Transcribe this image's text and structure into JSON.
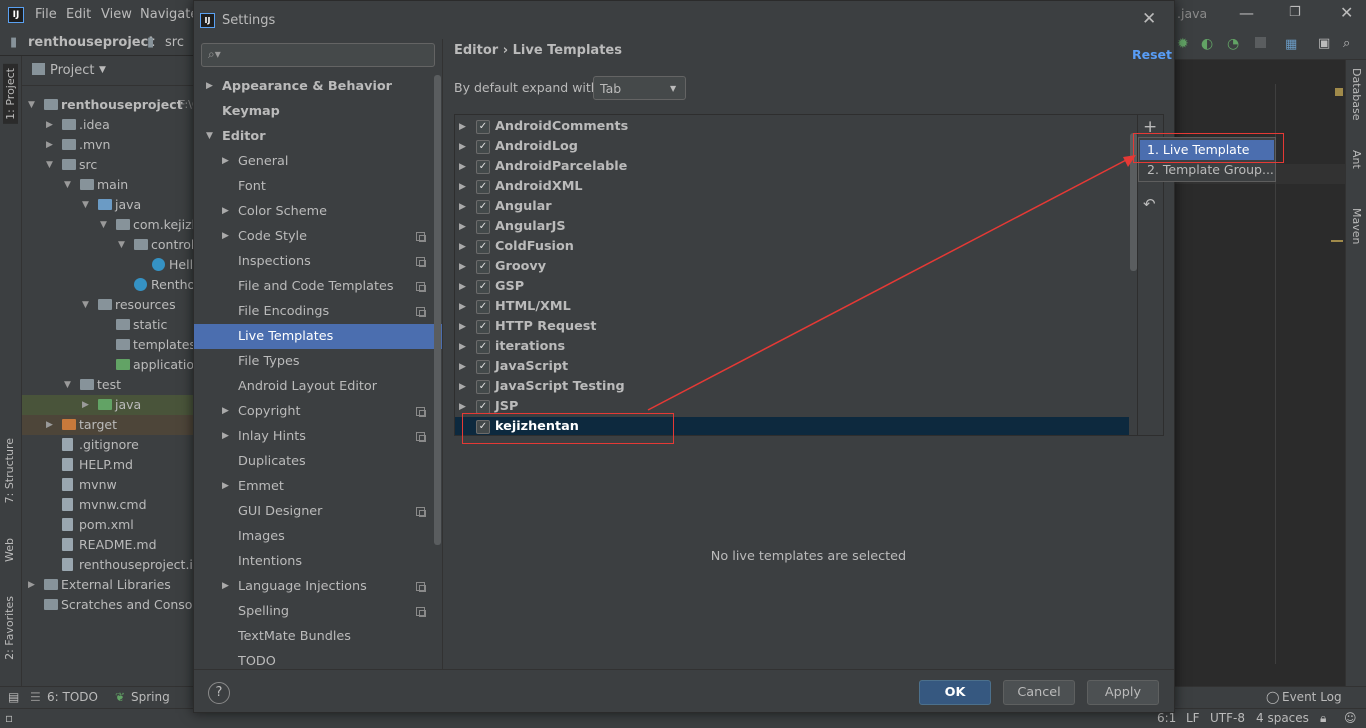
{
  "ide": {
    "menu": [
      "File",
      "Edit",
      "View",
      "Navigate"
    ],
    "breadcrumb": [
      "renthouseproject",
      "src"
    ],
    "left_tabs": [
      "1: Project",
      "7: Structure",
      "Web",
      "2: Favorites"
    ],
    "right_tabs": [
      "Database",
      "Ant",
      "Maven"
    ],
    "editor_tab": ".java",
    "project_panel_title": "Project",
    "tree": [
      {
        "label": "renthouseproject",
        "suffix": "F:\\C",
        "depth": 0,
        "arrow": "▼",
        "icon": "folder-icon",
        "bold": true
      },
      {
        "label": ".idea",
        "depth": 1,
        "arrow": "▶",
        "icon": "folder-icon"
      },
      {
        "label": ".mvn",
        "depth": 1,
        "arrow": "▶",
        "icon": "folder-icon"
      },
      {
        "label": "src",
        "depth": 1,
        "arrow": "▼",
        "icon": "folder-icon"
      },
      {
        "label": "main",
        "depth": 2,
        "arrow": "▼",
        "icon": "folder-icon"
      },
      {
        "label": "java",
        "depth": 3,
        "arrow": "▼",
        "icon": "source-folder-icon"
      },
      {
        "label": "com.kejizh",
        "depth": 4,
        "arrow": "▼",
        "icon": "package-icon"
      },
      {
        "label": "control",
        "depth": 5,
        "arrow": "▼",
        "icon": "package-icon"
      },
      {
        "label": "Hell",
        "depth": 6,
        "arrow": "",
        "icon": "class-icon"
      },
      {
        "label": "Rentho",
        "depth": 5,
        "arrow": "",
        "icon": "class-icon"
      },
      {
        "label": "resources",
        "depth": 3,
        "arrow": "▼",
        "icon": "resources-folder-icon"
      },
      {
        "label": "static",
        "depth": 4,
        "arrow": "",
        "icon": "folder-icon"
      },
      {
        "label": "templates",
        "depth": 4,
        "arrow": "",
        "icon": "folder-icon"
      },
      {
        "label": "application",
        "depth": 4,
        "arrow": "",
        "icon": "spring-config-icon"
      },
      {
        "label": "test",
        "depth": 2,
        "arrow": "▼",
        "icon": "folder-icon"
      },
      {
        "label": "java",
        "depth": 3,
        "arrow": "▶",
        "icon": "test-folder-icon",
        "highlight": true
      },
      {
        "label": "target",
        "depth": 1,
        "arrow": "▶",
        "icon": "excluded-folder-icon",
        "highlight": true
      },
      {
        "label": ".gitignore",
        "depth": 1,
        "arrow": "",
        "icon": "file-icon"
      },
      {
        "label": "HELP.md",
        "depth": 1,
        "arrow": "",
        "icon": "markdown-icon"
      },
      {
        "label": "mvnw",
        "depth": 1,
        "arrow": "",
        "icon": "file-icon"
      },
      {
        "label": "mvnw.cmd",
        "depth": 1,
        "arrow": "",
        "icon": "file-icon"
      },
      {
        "label": "pom.xml",
        "depth": 1,
        "arrow": "",
        "icon": "maven-icon"
      },
      {
        "label": "README.md",
        "depth": 1,
        "arrow": "",
        "icon": "markdown-icon"
      },
      {
        "label": "renthouseproject.im",
        "depth": 1,
        "arrow": "",
        "icon": "file-icon"
      },
      {
        "label": "External Libraries",
        "depth": 0,
        "arrow": "▶",
        "icon": "library-icon"
      },
      {
        "label": "Scratches and Console",
        "depth": 0,
        "arrow": "",
        "icon": "scratches-icon"
      }
    ],
    "bottom_tabs": [
      "6: TODO",
      "Spring"
    ],
    "event_log": "Event Log",
    "status": {
      "position": "6:1",
      "line_sep": "LF",
      "encoding": "UTF-8",
      "indent": "4 spaces"
    }
  },
  "dialog": {
    "title": "Settings",
    "search_placeholder": "",
    "nav": [
      {
        "label": "Appearance & Behavior",
        "depth": 0,
        "arrow": "▶",
        "bold": true
      },
      {
        "label": "Keymap",
        "depth": 0,
        "arrow": "",
        "bold": true
      },
      {
        "label": "Editor",
        "depth": 0,
        "arrow": "▼",
        "bold": true
      },
      {
        "label": "General",
        "depth": 1,
        "arrow": "▶"
      },
      {
        "label": "Font",
        "depth": 1,
        "arrow": ""
      },
      {
        "label": "Color Scheme",
        "depth": 1,
        "arrow": "▶"
      },
      {
        "label": "Code Style",
        "depth": 1,
        "arrow": "▶",
        "copy": true
      },
      {
        "label": "Inspections",
        "depth": 1,
        "arrow": "",
        "copy": true
      },
      {
        "label": "File and Code Templates",
        "depth": 1,
        "arrow": "",
        "copy": true
      },
      {
        "label": "File Encodings",
        "depth": 1,
        "arrow": "",
        "copy": true
      },
      {
        "label": "Live Templates",
        "depth": 1,
        "arrow": "",
        "selected": true
      },
      {
        "label": "File Types",
        "depth": 1,
        "arrow": ""
      },
      {
        "label": "Android Layout Editor",
        "depth": 1,
        "arrow": ""
      },
      {
        "label": "Copyright",
        "depth": 1,
        "arrow": "▶",
        "copy": true
      },
      {
        "label": "Inlay Hints",
        "depth": 1,
        "arrow": "▶",
        "copy": true
      },
      {
        "label": "Duplicates",
        "depth": 1,
        "arrow": ""
      },
      {
        "label": "Emmet",
        "depth": 1,
        "arrow": "▶"
      },
      {
        "label": "GUI Designer",
        "depth": 1,
        "arrow": "",
        "copy": true
      },
      {
        "label": "Images",
        "depth": 1,
        "arrow": ""
      },
      {
        "label": "Intentions",
        "depth": 1,
        "arrow": ""
      },
      {
        "label": "Language Injections",
        "depth": 1,
        "arrow": "▶",
        "copy": true
      },
      {
        "label": "Spelling",
        "depth": 1,
        "arrow": "",
        "copy": true
      },
      {
        "label": "TextMate Bundles",
        "depth": 1,
        "arrow": ""
      },
      {
        "label": "TODO",
        "depth": 1,
        "arrow": ""
      }
    ],
    "breadcrumb": "Editor  ›  Live Templates",
    "reset_label": "Reset",
    "expand_label": "By default expand with",
    "expand_value": "Tab",
    "templates": [
      {
        "name": "AndroidComments",
        "checked": true
      },
      {
        "name": "AndroidLog",
        "checked": true
      },
      {
        "name": "AndroidParcelable",
        "checked": true
      },
      {
        "name": "AndroidXML",
        "checked": true
      },
      {
        "name": "Angular",
        "checked": true
      },
      {
        "name": "AngularJS",
        "checked": true
      },
      {
        "name": "ColdFusion",
        "checked": true
      },
      {
        "name": "Groovy",
        "checked": true
      },
      {
        "name": "GSP",
        "checked": true
      },
      {
        "name": "HTML/XML",
        "checked": true
      },
      {
        "name": "HTTP Request",
        "checked": true
      },
      {
        "name": "iterations",
        "checked": true
      },
      {
        "name": "JavaScript",
        "checked": true
      },
      {
        "name": "JavaScript Testing",
        "checked": true
      },
      {
        "name": "JSP",
        "checked": true
      },
      {
        "name": "kejizhentan",
        "checked": true,
        "selected": true
      }
    ],
    "add_menu": [
      "1. Live Template",
      "2. Template Group..."
    ],
    "empty_message": "No live templates are selected",
    "buttons": {
      "ok": "OK",
      "cancel": "Cancel",
      "apply": "Apply"
    },
    "help": "?"
  },
  "colors": {
    "accent": "#4b6eaf",
    "annotation": "#e53935",
    "selected_row": "#0d293e",
    "link": "#589df6"
  }
}
